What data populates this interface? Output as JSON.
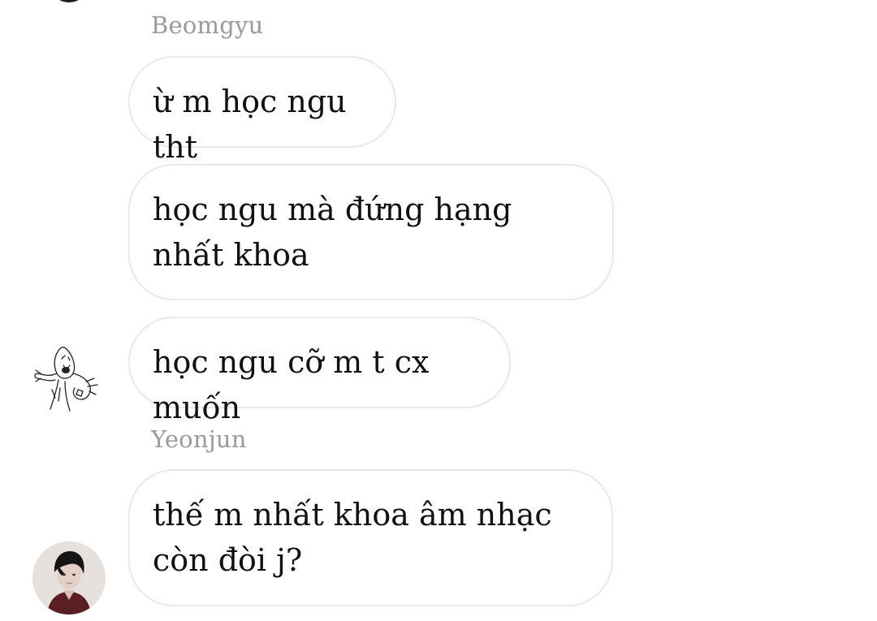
{
  "conversation": {
    "groups": [
      {
        "sender": "Beomgyu",
        "messages": [
          "ừ m học ngu tht",
          "học ngu mà đứng hạng nhất khoa",
          "học ngu cỡ m t cx muốn"
        ],
        "avatar": "sketch-figure-avatar"
      },
      {
        "sender": "Yeonjun",
        "messages": [
          "thế m nhất khoa âm nhạc còn đòi j?"
        ],
        "avatar": "profile-photo-avatar"
      }
    ]
  },
  "colors": {
    "background": "#ffffff",
    "bubble_border": "#e9e9e9",
    "sender_name": "#9a9a9a",
    "message_text": "#111111"
  }
}
